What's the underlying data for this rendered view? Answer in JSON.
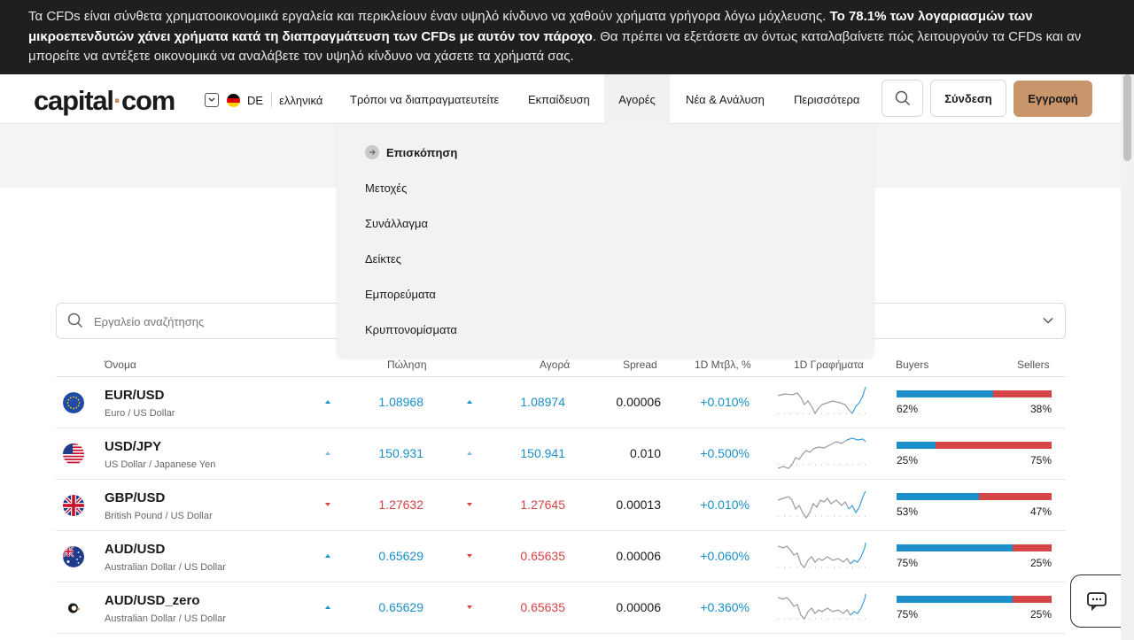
{
  "risk_banner": {
    "text_part1": "Τα CFDs είναι σύνθετα χρηματοοικονομικά εργαλεία και περικλείουν έναν υψηλό κίνδυνο να χαθούν χρήματα γρήγορα λόγω μόχλευσης. ",
    "text_bold": "Το 78.1% των λογαριασμών των μικροεπενδυτών χάνει χρήματα κατά τη διαπραγμάτευση των CFDs με αυτόν τον πάροχο",
    "text_part2": ". Θα πρέπει να εξετάσετε αν όντως καταλαβαίνετε πώς λειτουργούν τα CFDs και αν μπορείτε να αντέξετε οικονομικά να αναλάβετε τον υψηλό κίνδυνο να χάσετε τα χρήματά σας."
  },
  "header": {
    "logo_part1": "capital",
    "logo_dot": "·",
    "logo_part2": "com",
    "country_code": "DE",
    "language": "ελληνικά",
    "nav": [
      "Τρόποι να διαπραγματευτείτε",
      "Εκπαίδευση",
      "Αγορές",
      "Νέα & Ανάλυση",
      "Περισσότερα"
    ],
    "login": "Σύνδεση",
    "signup": "Εγγραφή"
  },
  "markets_menu": {
    "overview": "Επισκόπηση",
    "items": [
      "Μετοχές",
      "Συνάλλαγμα",
      "Δείκτες",
      "Εμπορεύματα",
      "Κρυπτονομίσματα"
    ]
  },
  "search": {
    "placeholder": "Εργαλείο αναζήτησης"
  },
  "table": {
    "headers": {
      "name": "Όνομα",
      "sell": "Πώληση",
      "buy": "Αγορά",
      "spread": "Spread",
      "change": "1D Μτβλ, %",
      "chart": "1D Γραφήματα",
      "buyers": "Buyers",
      "sellers": "Sellers"
    },
    "rows": [
      {
        "symbol": "EUR/USD",
        "desc": "Euro / US Dollar",
        "sell": "1.08968",
        "buy": "1.08974",
        "spread": "0.00006",
        "change": "+0.010%",
        "buyers": "62%",
        "sellers": "38%",
        "buyers_fraction": 0.62,
        "sell_dir": "up",
        "buy_dir": "up"
      },
      {
        "symbol": "USD/JPY",
        "desc": "US Dollar / Japanese Yen",
        "sell": "150.931",
        "buy": "150.941",
        "spread": "0.010",
        "change": "+0.500%",
        "buyers": "25%",
        "sellers": "75%",
        "buyers_fraction": 0.25,
        "sell_dir": "up-faint",
        "buy_dir": "up-faint"
      },
      {
        "symbol": "GBP/USD",
        "desc": "British Pound / US Dollar",
        "sell": "1.27632",
        "buy": "1.27645",
        "spread": "0.00013",
        "change": "+0.010%",
        "buyers": "53%",
        "sellers": "47%",
        "buyers_fraction": 0.53,
        "sell_dir": "down",
        "buy_dir": "down"
      },
      {
        "symbol": "AUD/USD",
        "desc": "Australian Dollar / US Dollar",
        "sell": "0.65629",
        "buy": "0.65635",
        "spread": "0.00006",
        "change": "+0.060%",
        "buyers": "75%",
        "sellers": "25%",
        "buyers_fraction": 0.75,
        "sell_dir": "up",
        "buy_dir": "down"
      },
      {
        "symbol": "AUD/USD_zero",
        "desc": "Australian Dollar / US Dollar",
        "sell": "0.65629",
        "buy": "0.65635",
        "spread": "0.00006",
        "change": "+0.360%",
        "buyers": "75%",
        "sellers": "25%",
        "buyers_fraction": 0.75,
        "sell_dir": "up",
        "buy_dir": "down"
      }
    ]
  },
  "colors": {
    "up": "#1a8fc8",
    "down": "#d64545",
    "accent": "#c9956b"
  }
}
